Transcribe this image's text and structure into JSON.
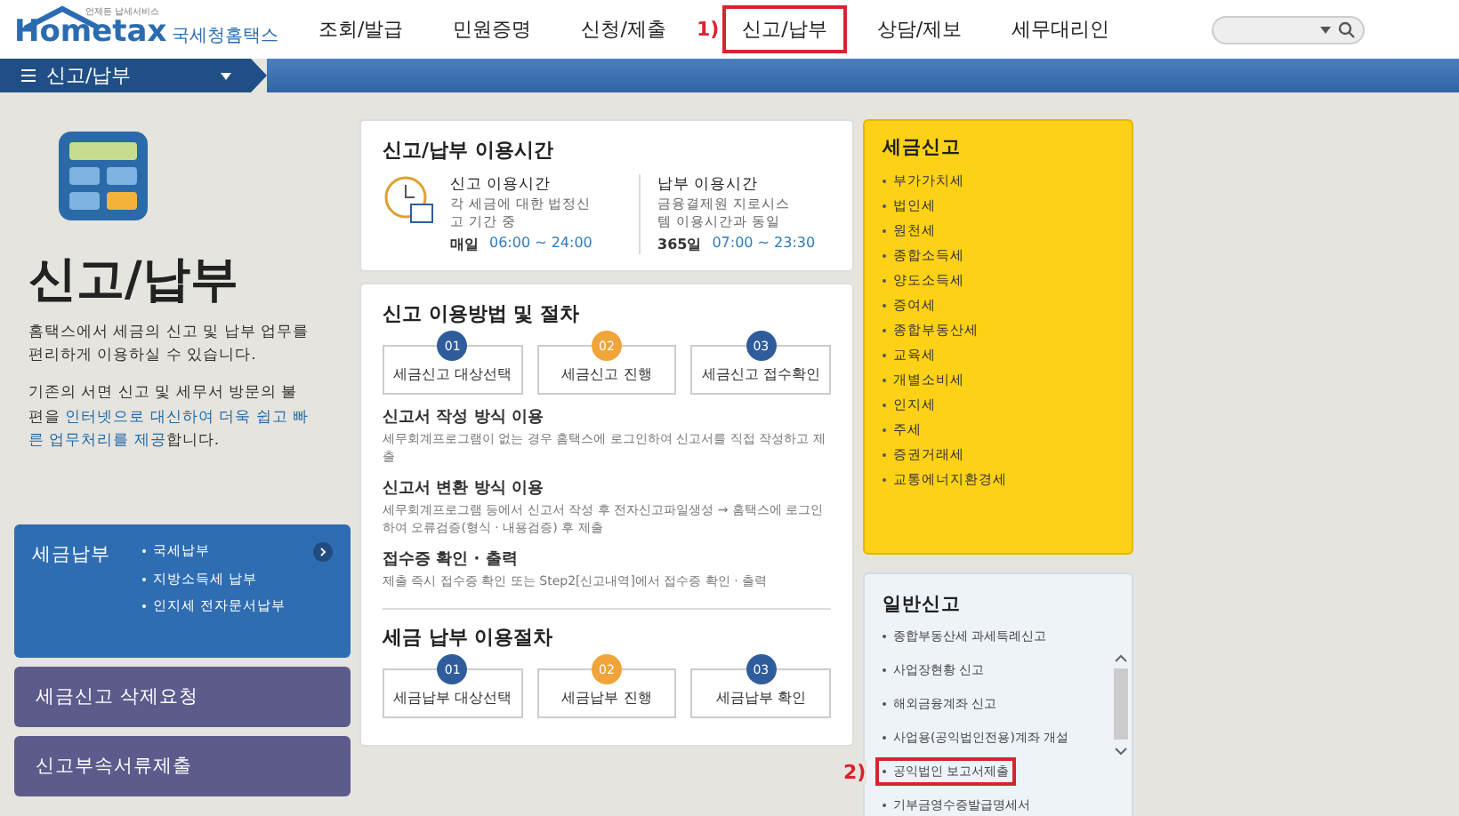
{
  "header": {
    "logo": {
      "brand": "Hometax",
      "subtitle": "국세청홈택스",
      "tagline": "언제든 납세서비스"
    },
    "nav": [
      {
        "label": "조회/발급",
        "highlighted": false
      },
      {
        "label": "민원증명",
        "highlighted": false
      },
      {
        "label": "신청/제출",
        "highlighted": false
      },
      {
        "label": "신고/납부",
        "highlighted": true,
        "marker": "1)"
      },
      {
        "label": "상담/제보",
        "highlighted": false
      },
      {
        "label": "세무대리인",
        "highlighted": false
      }
    ]
  },
  "menu_bar": {
    "label": "신고/납부"
  },
  "intro": {
    "title": "신고/납부",
    "paragraphs": [
      "홈택스에서 세금의 신고 및 납부 업무를 편리하게 이용하실 수 있습니다.",
      "기존의 서면 신고 및 세무서 방문의 불편을 **인터넷으로 대신하여 더욱 쉽고 빠른 업무처리를 제공**합니다."
    ]
  },
  "side_menu": [
    {
      "kind": "links",
      "title": "세금납부",
      "links": [
        "국세납부",
        "지방소득세 납부",
        "인지세 전자문서납부"
      ]
    },
    {
      "kind": "plain",
      "title": "세금신고 삭제요청"
    },
    {
      "kind": "plain",
      "title": "신고부속서류제출"
    }
  ],
  "hours": {
    "title": "신고/납부 이용시간",
    "blocks": [
      {
        "title": "신고 이용시간",
        "desc": "각 세금에 대한 법정신고 기간 중",
        "day": "매일",
        "time": "06:00 ~ 24:00"
      },
      {
        "title": "납부 이용시간",
        "desc": "금융결제원 지로시스템 이용시간과 동일",
        "day": "365일",
        "time": "07:00 ~ 23:30"
      }
    ]
  },
  "filing_procedure": {
    "title": "신고 이용방법 및 절차",
    "steps": [
      {
        "number": "01",
        "label": "세금신고 대상선택",
        "color": "#2f5d9b"
      },
      {
        "number": "02",
        "label": "세금신고 진행",
        "color": "#f0a43a"
      },
      {
        "number": "03",
        "label": "세금신고 접수확인",
        "color": "#2f5d9b"
      }
    ],
    "methods": [
      {
        "title": "신고서 작성 방식 이용",
        "desc": "세무회계프로그램이 없는 경우 홈택스에 로그인하여 신고서를 직접 작성하고 제출"
      },
      {
        "title": "신고서 변환 방식 이용",
        "desc": "세무회계프로그램 등에서 신고서 작성 후 전자신고파일생성 → 홈택스에 로그인하여 오류검증(형식 · 내용검증) 후 제출"
      },
      {
        "title": "접수증 확인 · 출력",
        "desc": "제출 즉시 접수증 확인 또는 Step2[신고내역]에서 접수증 확인 · 출력"
      }
    ]
  },
  "payment_procedure": {
    "title": "세금 납부 이용절차",
    "steps": [
      {
        "number": "01",
        "label": "세금납부 대상선택",
        "color": "#2f5d9b"
      },
      {
        "number": "02",
        "label": "세금납부 진행",
        "color": "#f0a43a"
      },
      {
        "number": "03",
        "label": "세금납부 확인",
        "color": "#2f5d9b"
      }
    ]
  },
  "tax_filing": {
    "title": "세금신고",
    "items": [
      "부가가치세",
      "법인세",
      "원천세",
      "종합소득세",
      "양도소득세",
      "증여세",
      "종합부동산세",
      "교육세",
      "개별소비세",
      "인지세",
      "주세",
      "증권거래세",
      "교통에너지환경세"
    ]
  },
  "general_filing": {
    "title": "일반신고",
    "items": [
      {
        "label": "종합부동산세 과세특례신고",
        "highlighted": false
      },
      {
        "label": "사업장현황 신고",
        "highlighted": false
      },
      {
        "label": "해외금융계좌 신고",
        "highlighted": false
      },
      {
        "label": "사업용(공익법인전용)계좌 개설",
        "highlighted": false
      },
      {
        "label": "공익법인 보고서제출",
        "highlighted": true,
        "marker": "2)"
      },
      {
        "label": "기부금영수증발급명세서",
        "highlighted": false
      }
    ]
  }
}
